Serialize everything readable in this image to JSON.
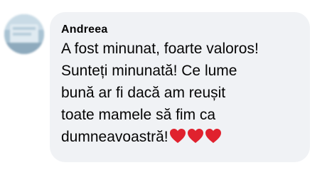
{
  "comment": {
    "author": "Andreea",
    "lines": [
      "A fost minunat, foarte valoros!",
      "Sunteți minunată! Ce lume",
      "bună ar fi dacă am reușit",
      "toate mamele să fim ca",
      "dumneavoastră!"
    ],
    "reaction_icons": [
      "heart-icon",
      "heart-icon",
      "heart-icon"
    ],
    "heart_color": "#e0222e",
    "bubble_color": "#f0f2f5",
    "text_color": "#050505"
  }
}
